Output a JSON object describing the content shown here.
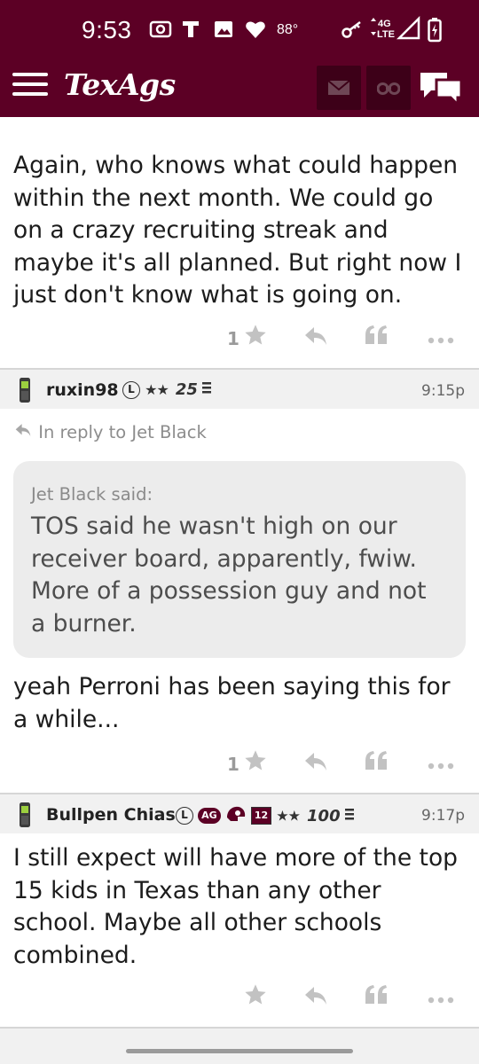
{
  "status_bar": {
    "time": "9:53",
    "temperature": "88°",
    "network": "4G LTE"
  },
  "app": {
    "logo": "TexAgs"
  },
  "posts": [
    {
      "text": "Again, who knows what could happen within the next month. We could go on a crazy recruiting streak and maybe it's all planned. But right now I just don't know what is going on.",
      "likes": "1"
    },
    {
      "username": "ruxin98",
      "badge_letter": "L",
      "stars": "★★",
      "points": "25",
      "time": "9:15p",
      "reply_to": "In reply to Jet Black",
      "quote_author": "Jet Black said:",
      "quote_text": "TOS said he wasn't high on our receiver board, apparently, fwiw. More of a possession guy and not a burner.",
      "text": "yeah Perroni has been saying this for a while...",
      "likes": "1"
    },
    {
      "username": "Bullpen Chias",
      "badge_letter": "L",
      "badge_ag": "AG",
      "badge_12": "12",
      "stars": "★★",
      "points": "100",
      "time": "9:17p",
      "text": "I still expect will have more of the top 15 kids in Texas than any other school. Maybe all other schools combined.",
      "likes": ""
    }
  ],
  "colors": {
    "header": "#5c0025",
    "header_button": "#3d0018",
    "action_gray": "#b3b3b3"
  }
}
